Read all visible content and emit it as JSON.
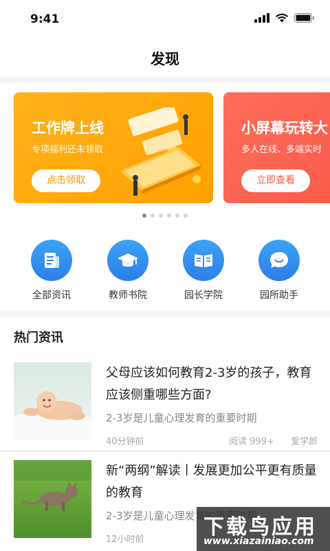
{
  "status_bar": {
    "time": "9:41"
  },
  "header": {
    "title": "发现"
  },
  "banners": [
    {
      "title": "工作牌上线",
      "subtitle": "专项福利还未领取",
      "button": "点击领取"
    },
    {
      "title": "小屏幕玩转大",
      "subtitle": "多人在线、多端实时",
      "button": "立即查看"
    }
  ],
  "carousel": {
    "count": 6,
    "active": 1
  },
  "shortcuts": [
    {
      "label": "全部资讯",
      "icon": "document-icon"
    },
    {
      "label": "教师书院",
      "icon": "graduation-cap-icon"
    },
    {
      "label": "园长学院",
      "icon": "open-book-icon"
    },
    {
      "label": "园所助手",
      "icon": "chat-bubble-icon"
    }
  ],
  "section": {
    "title": "热门资讯"
  },
  "news": [
    {
      "title": "父母应该如何教育2-3岁的孩子，教育应该侧重哪些方面?",
      "desc": "2-3岁是儿童心理发育的重要时期",
      "time": "40分钟前",
      "reads": "阅读 999+",
      "source": "爱学郎"
    },
    {
      "title": "新“两纲”解读丨发展更加公平更有质量的教育",
      "desc": "2-3岁是儿童心理发育的重要时期",
      "time": "12小时前"
    }
  ],
  "watermark": {
    "cn": "下载鸟应用",
    "en": "www.xiazainiao.com"
  },
  "colors": {
    "accent_blue": "#2b7fe8",
    "banner_orange": "#ffa000",
    "banner_red": "#f85a4a"
  }
}
